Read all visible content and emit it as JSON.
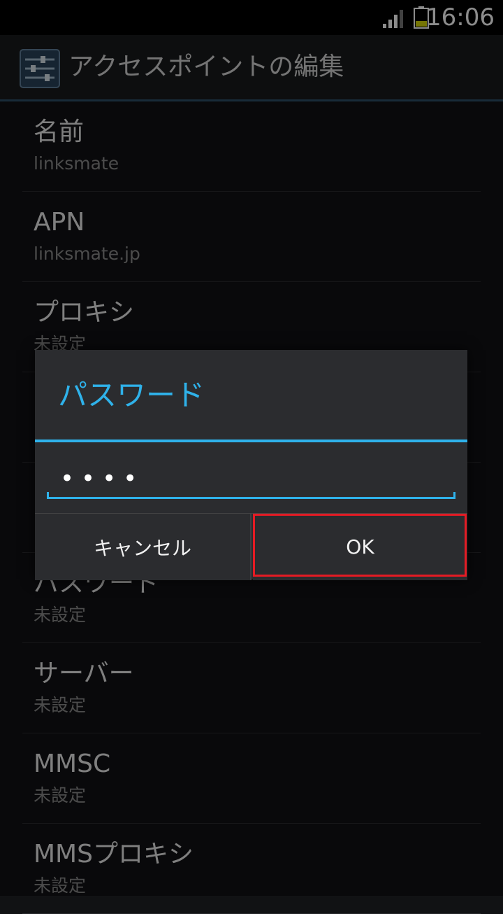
{
  "status_bar": {
    "time": "16:06"
  },
  "action_bar": {
    "title": "アクセスポイントの編集",
    "icon": "settings-sliders-icon"
  },
  "settings": [
    {
      "title": "名前",
      "value": "linksmate"
    },
    {
      "title": "APN",
      "value": "linksmate.jp"
    },
    {
      "title": "プロキシ",
      "value": "未設定"
    },
    {
      "title": "",
      "value": ""
    },
    {
      "title": "",
      "value": ""
    },
    {
      "title": "パスワード",
      "value": "未設定"
    },
    {
      "title": "サーバー",
      "value": "未設定"
    },
    {
      "title": "MMSC",
      "value": "未設定"
    },
    {
      "title": "MMSプロキシ",
      "value": "未設定"
    }
  ],
  "dialog": {
    "title": "パスワード",
    "input_value": "••••",
    "cancel_label": "キャンセル",
    "ok_label": "OK"
  },
  "colors": {
    "accent": "#2fb2ea",
    "highlight": "#e51b24",
    "battery": "#d6d60a"
  }
}
